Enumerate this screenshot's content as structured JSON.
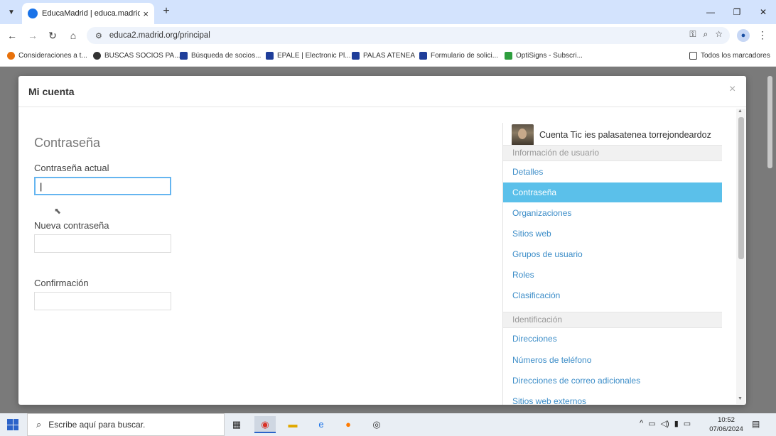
{
  "browser": {
    "tab_title": "EducaMadrid | educa.madrid.or",
    "tab_close": "×",
    "new_tab": "+",
    "url": "educa2.madrid.org/principal",
    "window_controls": [
      "—",
      "❐",
      "✕"
    ]
  },
  "bookmarks": {
    "items": [
      {
        "label": "Consideraciones a t...",
        "color": "#e8710a"
      },
      {
        "label": "BUSCAS SOCIOS PA...",
        "color": "#333333"
      },
      {
        "label": "Búsqueda de socios...",
        "color": "#1f3e9a"
      },
      {
        "label": "EPALE | Electronic Pl...",
        "color": "#1f3e9a"
      },
      {
        "label": "PALAS ATENEA",
        "color": "#1f3e9a"
      },
      {
        "label": "Formulario de solici...",
        "color": "#1f3e9a"
      },
      {
        "label": "OptiSigns - Subscri...",
        "color": "#2e9e3e"
      }
    ],
    "all_bookmarks": "Todos los marcadores"
  },
  "modal": {
    "title": "Mi cuenta",
    "close": "×",
    "section_title": "Contraseña",
    "fields": {
      "current_label": "Contraseña actual",
      "current_value": "|",
      "new_label": "Nueva contraseña",
      "confirm_label": "Confirmación"
    },
    "user_name": "Cuenta Tic ies palasatenea torrejondeardoz",
    "nav": {
      "header_user": "Información de usuario",
      "items_user": [
        "Detalles",
        "Contraseña",
        "Organizaciones",
        "Sitios web",
        "Grupos de usuario",
        "Roles",
        "Clasificación"
      ],
      "active_item": "Contraseña",
      "header_ident": "Identificación",
      "items_ident": [
        "Direcciones",
        "Números de teléfono",
        "Direcciones de correo adicionales",
        "Sitios web externos"
      ]
    }
  },
  "taskbar": {
    "search_placeholder": "Escribe aquí para buscar.",
    "time": "10:52",
    "date": "07/06/2024"
  },
  "colors": {
    "accent_active": "#5bc0ea",
    "link": "#3c8dc8",
    "focus_border": "#65b5f0"
  }
}
